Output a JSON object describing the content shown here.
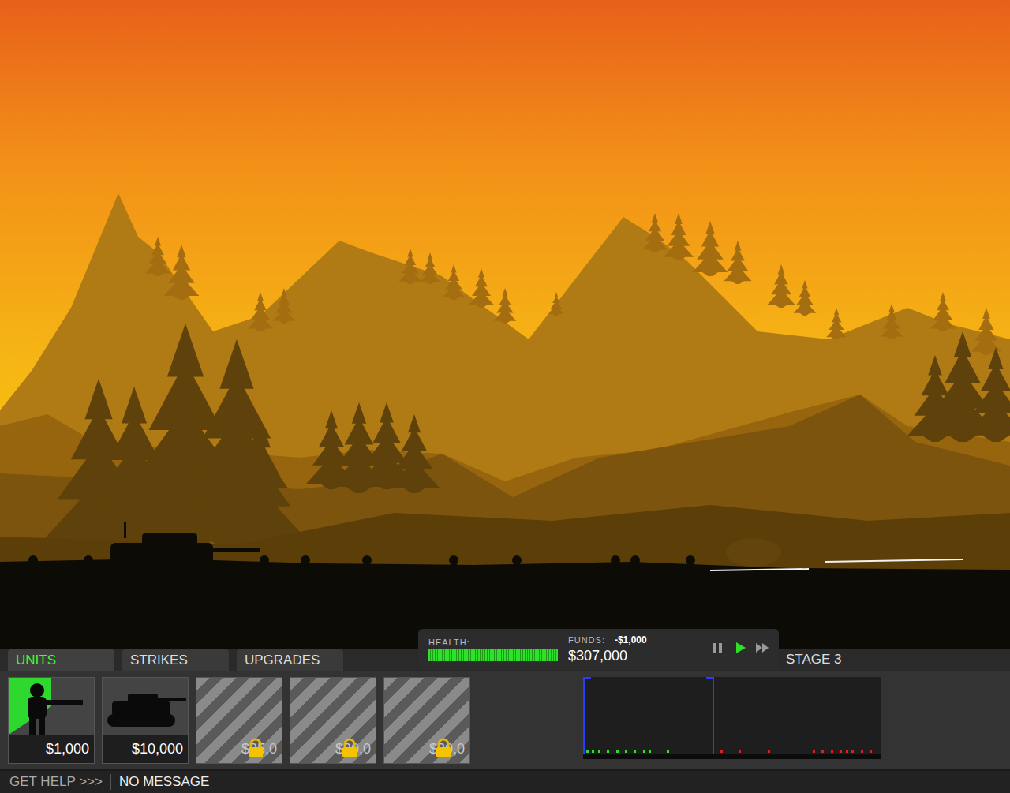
{
  "tabs": [
    {
      "label": "UNITS",
      "selected": true
    },
    {
      "label": "STRIKES",
      "selected": false
    },
    {
      "label": "UPGRADES",
      "selected": false
    }
  ],
  "hud": {
    "health_label": "HEALTH:",
    "health_level": 1.0,
    "funds_label": "FUNDS:",
    "funds_change": "-$1,000",
    "funds": "$307,000",
    "controls": [
      {
        "kind": "pause",
        "selected": false
      },
      {
        "kind": "play",
        "selected": true
      },
      {
        "kind": "fast",
        "selected": false
      }
    ]
  },
  "stage": "STAGE 3",
  "units": [
    {
      "kind": "soldier",
      "price": "$1,000",
      "locked": false,
      "selected": true
    },
    {
      "kind": "tank",
      "price": "$10,000",
      "locked": false,
      "selected": false
    },
    {
      "kind": "locked",
      "price": "$25,0",
      "locked": true,
      "selected": false
    },
    {
      "kind": "locked",
      "price": "$20,0",
      "locked": true,
      "selected": false
    },
    {
      "kind": "locked",
      "price": "$20,0",
      "locked": true,
      "selected": false
    }
  ],
  "minimap": {
    "view_level": 0.44,
    "friendly": [
      0.01,
      0.03,
      0.05,
      0.08,
      0.11,
      0.14,
      0.17,
      0.2,
      0.22,
      0.28
    ],
    "enemy": [
      0.46,
      0.52,
      0.62,
      0.77,
      0.8,
      0.83,
      0.86,
      0.88,
      0.9,
      0.93,
      0.96
    ]
  },
  "help": "GET HELP >>>",
  "message": "NO MESSAGE"
}
